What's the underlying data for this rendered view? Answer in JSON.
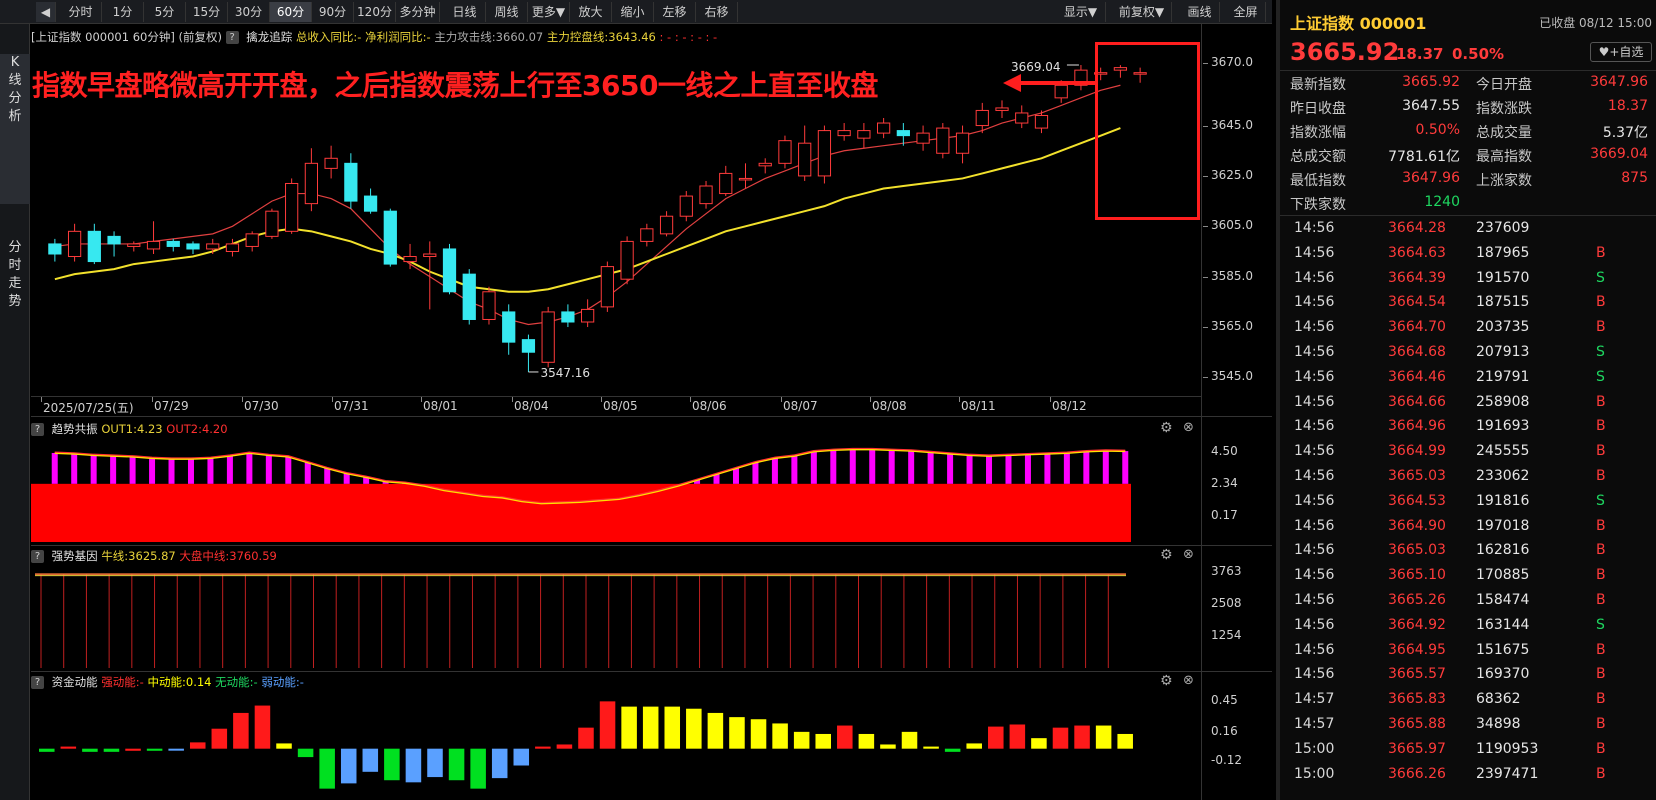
{
  "toolbar": {
    "buttons": [
      "分时",
      "1分",
      "5分",
      "15分",
      "30分",
      "60分",
      "90分",
      "120分",
      "多分钟",
      "日线",
      "周线",
      "更多▼",
      "放大",
      "缩小",
      "左移",
      "右移"
    ],
    "right_buttons": [
      "显示▼",
      "前复权▼",
      "画线",
      "全屏"
    ],
    "active": "60分",
    "back_icon": "◀"
  },
  "left_tabs": [
    "K线分析",
    "分时走势"
  ],
  "main_header": {
    "title": "[上证指数 000001 60分钟]",
    "adjust": "(前复权)",
    "indicator": "擒龙追踪",
    "item1": "总收入同比:-",
    "item2": "净利润同比:-",
    "item3": "主力攻击线:3660.07",
    "item4": "主力控盘线:3643.46",
    "dots": ": - : - : - : -"
  },
  "annotation": {
    "text": "指数早盘略微高开开盘，之后指数震荡上行至3650一线之上直至收盘",
    "high_label": "3669.04",
    "low_label": "3547.16",
    "color": "#ff2020"
  },
  "price_axis": [
    "3670.0",
    "3645.0",
    "3625.0",
    "3605.0",
    "3585.0",
    "3565.0",
    "3545.0"
  ],
  "date_axis": [
    "2025/07/25(五)",
    "07/29",
    "07/30",
    "07/31",
    "08/01",
    "08/04",
    "08/05",
    "08/06",
    "08/07",
    "08/08",
    "08/11",
    "08/12"
  ],
  "chart_data": [
    {
      "type": "candlestick",
      "title": "上证指数 000001 60分钟",
      "ylim": [
        3540,
        3675
      ],
      "x": [
        "07/25",
        "07/25",
        "07/25",
        "07/25",
        "07/28",
        "07/28",
        "07/28",
        "07/28",
        "07/29",
        "07/29",
        "07/29",
        "07/29",
        "07/30",
        "07/30",
        "07/30",
        "07/30",
        "07/31",
        "07/31",
        "07/31",
        "07/31",
        "08/01",
        "08/01",
        "08/01",
        "08/01",
        "08/04",
        "08/04",
        "08/04",
        "08/04",
        "08/05",
        "08/05",
        "08/05",
        "08/05",
        "08/06",
        "08/06",
        "08/06",
        "08/06",
        "08/07",
        "08/07",
        "08/07",
        "08/07",
        "08/08",
        "08/08",
        "08/08",
        "08/08",
        "08/11",
        "08/11",
        "08/11",
        "08/11",
        "08/12",
        "08/12",
        "08/12",
        "08/12"
      ],
      "open": [
        3598,
        3593,
        3603,
        3601,
        3597,
        3596,
        3599,
        3598,
        3596,
        3595,
        3597,
        3601,
        3603,
        3614,
        3628,
        3630,
        3617,
        3611,
        3591,
        3593,
        3596,
        3586,
        3568,
        3571,
        3560,
        3551,
        3571,
        3567,
        3573,
        3584,
        3599,
        3602,
        3609,
        3614,
        3618,
        3624,
        3629,
        3630,
        3625,
        3625,
        3641,
        3640,
        3642,
        3643,
        3638,
        3634,
        3634,
        3645,
        3651,
        3646,
        3644,
        3656,
        3661,
        3666,
        3667,
        3666
      ],
      "close": [
        3594,
        3603,
        3591,
        3598,
        3598,
        3599,
        3597,
        3596,
        3598,
        3598,
        3602,
        3611,
        3622,
        3630,
        3632,
        3615,
        3611,
        3590,
        3593,
        3594,
        3579,
        3568,
        3579,
        3559,
        3555,
        3571,
        3567,
        3572,
        3589,
        3599,
        3604,
        3609,
        3617,
        3621,
        3626,
        3624,
        3630,
        3639,
        3638,
        3643,
        3643,
        3643,
        3646,
        3641,
        3642,
        3644,
        3642,
        3651,
        3652,
        3650,
        3649,
        3661,
        3667,
        3666,
        3668,
        3666
      ],
      "high": [
        3600,
        3606,
        3606,
        3603,
        3599,
        3607,
        3600,
        3599,
        3600,
        3600,
        3603,
        3612,
        3624,
        3636,
        3637,
        3634,
        3620,
        3612,
        3598,
        3599,
        3598,
        3588,
        3581,
        3574,
        3562,
        3573,
        3574,
        3576,
        3591,
        3601,
        3606,
        3611,
        3619,
        3623,
        3629,
        3630,
        3632,
        3641,
        3645,
        3645,
        3646,
        3646,
        3648,
        3646,
        3645,
        3646,
        3645,
        3654,
        3655,
        3653,
        3651,
        3663,
        3669.04,
        3668,
        3669,
        3668
      ],
      "low": [
        3591,
        3591,
        3590,
        3593,
        3595,
        3594,
        3595,
        3594,
        3594,
        3593,
        3595,
        3600,
        3602,
        3611,
        3624,
        3612,
        3610,
        3589,
        3588,
        3572,
        3578,
        3566,
        3566,
        3554,
        3547.16,
        3549,
        3565,
        3565,
        3571,
        3582,
        3597,
        3601,
        3607,
        3612,
        3617,
        3620,
        3626,
        3628,
        3623,
        3622,
        3639,
        3636,
        3640,
        3637,
        3635,
        3632,
        3630,
        3642,
        3648,
        3644,
        3642,
        3654,
        3659,
        3663,
        3664,
        3662
      ],
      "ma_fast": [
        3597,
        3598,
        3598,
        3598,
        3598,
        3599,
        3600,
        3601,
        3602,
        3605,
        3610,
        3615,
        3618,
        3618,
        3616,
        3612,
        3604,
        3596,
        3590,
        3585,
        3580,
        3575,
        3572,
        3568,
        3566,
        3567,
        3569,
        3572,
        3577,
        3583,
        3590,
        3597,
        3604,
        3610,
        3616,
        3620,
        3624,
        3627,
        3630,
        3633,
        3635,
        3636,
        3637,
        3638,
        3639,
        3640,
        3641,
        3643,
        3646,
        3648,
        3650,
        3653,
        3656,
        3659,
        3661
      ],
      "ma_slow": [
        3584,
        3586,
        3587,
        3588,
        3590,
        3591,
        3592,
        3593,
        3595,
        3598,
        3601,
        3603,
        3604,
        3603,
        3601,
        3599,
        3596,
        3594,
        3591,
        3587,
        3584,
        3581,
        3580,
        3579,
        3579,
        3580,
        3582,
        3584,
        3586,
        3588,
        3591,
        3594,
        3597,
        3600,
        3603,
        3605,
        3607,
        3609,
        3611,
        3613,
        3616,
        3618,
        3620,
        3621,
        3622,
        3623,
        3624,
        3626,
        3628,
        3630,
        3632,
        3635,
        3638,
        3641,
        3644
      ]
    },
    {
      "type": "bar",
      "title": "趋势共振",
      "series": [
        {
          "name": "OUT1",
          "label": "OUT1:4.23",
          "values": [
            4.45,
            4.4,
            4.3,
            4.25,
            4.2,
            4.1,
            4.05,
            4.05,
            4.1,
            4.25,
            4.45,
            4.3,
            4.2,
            3.8,
            3.4,
            3.05,
            2.8,
            2.5,
            2.4,
            2.2,
            1.9,
            1.7,
            1.5,
            1.4,
            1.15,
            1.0,
            1.05,
            1.1,
            1.2,
            1.3,
            1.55,
            1.85,
            2.2,
            2.6,
            3.0,
            3.4,
            3.8,
            4.1,
            4.25,
            4.55,
            4.65,
            4.7,
            4.7,
            4.65,
            4.6,
            4.5,
            4.4,
            4.3,
            4.25,
            4.3,
            4.35,
            4.4,
            4.45,
            4.55,
            4.6,
            4.58
          ]
        },
        {
          "name": "OUT2",
          "label": "OUT2:4.20"
        }
      ],
      "y_ticks": [
        "4.50",
        "2.34",
        "0.17"
      ],
      "ylim": [
        -1.5,
        5.2
      ]
    },
    {
      "type": "bar",
      "title": "强势基因",
      "series": [
        {
          "name": "牛线",
          "label": "牛线:3625.87"
        },
        {
          "name": "大盘中线",
          "label": "大盘中线:3760.59"
        }
      ],
      "y_ticks": [
        "3763",
        "2508",
        "1254"
      ],
      "ylim": [
        0,
        3900
      ]
    },
    {
      "type": "bar",
      "title": "资金动能",
      "series": [
        {
          "name": "强动能",
          "label": "强动能:-"
        },
        {
          "name": "中动能",
          "label": "中动能:0.14"
        },
        {
          "name": "无动能",
          "label": "无动能:-"
        },
        {
          "name": "弱动能",
          "label": "弱动能:-"
        }
      ],
      "values": [
        -0.03,
        0.02,
        -0.03,
        -0.03,
        -0.02,
        -0.02,
        -0.01,
        0.06,
        0.19,
        0.34,
        0.41,
        0.05,
        -0.08,
        -0.38,
        -0.33,
        -0.22,
        -0.3,
        -0.32,
        -0.27,
        -0.3,
        -0.38,
        -0.28,
        -0.16,
        0.02,
        0.04,
        0.2,
        0.45,
        0.4,
        0.4,
        0.4,
        0.38,
        0.34,
        0.3,
        0.28,
        0.24,
        0.16,
        0.14,
        0.22,
        0.14,
        0.04,
        0.16,
        0.02,
        -0.03,
        0.05,
        0.21,
        0.23,
        0.1,
        0.2,
        0.22,
        0.22,
        0.14
      ],
      "colors": [
        "green",
        "red",
        "green",
        "green",
        "red",
        "green",
        "blue",
        "red",
        "red",
        "red",
        "red",
        "yellow",
        "green",
        "green",
        "blue",
        "blue",
        "green",
        "blue",
        "blue",
        "green",
        "green",
        "blue",
        "blue",
        "red",
        "red",
        "red",
        "red",
        "yellow",
        "yellow",
        "yellow",
        "yellow",
        "yellow",
        "yellow",
        "yellow",
        "yellow",
        "yellow",
        "yellow",
        "red",
        "yellow",
        "yellow",
        "yellow",
        "yellow",
        "green",
        "yellow",
        "red",
        "red",
        "yellow",
        "red",
        "red",
        "yellow",
        "yellow"
      ],
      "y_ticks": [
        "0.45",
        "0.16",
        "-0.12"
      ],
      "ylim": [
        -0.45,
        0.52
      ]
    }
  ],
  "quote": {
    "name": "上证指数 000001",
    "status": "已收盘 08/12 15:00",
    "price": "3665.92",
    "change": "18.37",
    "pct": "0.50%",
    "watch_label": "+自选",
    "fields": [
      [
        "最新指数",
        "3665.92",
        "red",
        "今日开盘",
        "3647.96",
        "red"
      ],
      [
        "昨日收盘",
        "3647.55",
        "white",
        "指数涨跌",
        "18.37",
        "red"
      ],
      [
        "指数涨幅",
        "0.50%",
        "red",
        "总成交量",
        "5.37亿",
        "white"
      ],
      [
        "总成交额",
        "7781.61亿",
        "white",
        "最高指数",
        "3669.04",
        "red"
      ],
      [
        "最低指数",
        "3647.96",
        "red",
        "上涨家数",
        "875",
        "red"
      ],
      [
        "下跌家数",
        "1240",
        "green",
        "",
        "",
        " "
      ]
    ]
  },
  "ticks": [
    [
      "14:56",
      "3664.28",
      "237609",
      ""
    ],
    [
      "14:56",
      "3664.63",
      "187965",
      "B"
    ],
    [
      "14:56",
      "3664.39",
      "191570",
      "S"
    ],
    [
      "14:56",
      "3664.54",
      "187515",
      "B"
    ],
    [
      "14:56",
      "3664.70",
      "203735",
      "B"
    ],
    [
      "14:56",
      "3664.68",
      "207913",
      "S"
    ],
    [
      "14:56",
      "3664.46",
      "219791",
      "S"
    ],
    [
      "14:56",
      "3664.66",
      "258908",
      "B"
    ],
    [
      "14:56",
      "3664.96",
      "191693",
      "B"
    ],
    [
      "14:56",
      "3664.99",
      "245555",
      "B"
    ],
    [
      "14:56",
      "3665.03",
      "233062",
      "B"
    ],
    [
      "14:56",
      "3664.53",
      "191816",
      "S"
    ],
    [
      "14:56",
      "3664.90",
      "197018",
      "B"
    ],
    [
      "14:56",
      "3665.03",
      "162816",
      "B"
    ],
    [
      "14:56",
      "3665.10",
      "170885",
      "B"
    ],
    [
      "14:56",
      "3665.26",
      "158474",
      "B"
    ],
    [
      "14:56",
      "3664.92",
      "163144",
      "S"
    ],
    [
      "14:56",
      "3664.95",
      "151675",
      "B"
    ],
    [
      "14:56",
      "3665.57",
      "169370",
      "B"
    ],
    [
      "14:57",
      "3665.83",
      "68362",
      "B"
    ],
    [
      "14:57",
      "3665.88",
      "34898",
      "B"
    ],
    [
      "15:00",
      "3665.97",
      "1190953",
      "B"
    ],
    [
      "15:00",
      "3666.26",
      "2397471",
      "B"
    ]
  ]
}
